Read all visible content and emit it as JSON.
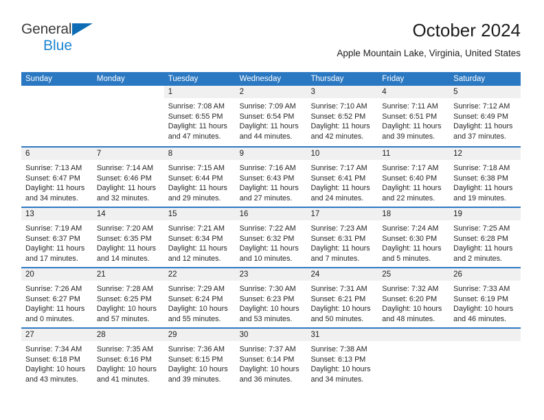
{
  "brand": {
    "name_part1": "General",
    "name_part2": "Blue",
    "triangle_color": "#0d6cb5",
    "blue_text_color": "#1a84d0"
  },
  "header": {
    "title": "October 2024",
    "subtitle": "Apple Mountain Lake, Virginia, United States",
    "header_bg_color": "#2b78c2",
    "daynum_band_color": "#f0f0f0"
  },
  "weekdays": [
    "Sunday",
    "Monday",
    "Tuesday",
    "Wednesday",
    "Thursday",
    "Friday",
    "Saturday"
  ],
  "weeks": [
    [
      {
        "day": "",
        "lines": []
      },
      {
        "day": "",
        "lines": []
      },
      {
        "day": "1",
        "lines": [
          "Sunrise: 7:08 AM",
          "Sunset: 6:55 PM",
          "Daylight: 11 hours",
          "and 47 minutes."
        ]
      },
      {
        "day": "2",
        "lines": [
          "Sunrise: 7:09 AM",
          "Sunset: 6:54 PM",
          "Daylight: 11 hours",
          "and 44 minutes."
        ]
      },
      {
        "day": "3",
        "lines": [
          "Sunrise: 7:10 AM",
          "Sunset: 6:52 PM",
          "Daylight: 11 hours",
          "and 42 minutes."
        ]
      },
      {
        "day": "4",
        "lines": [
          "Sunrise: 7:11 AM",
          "Sunset: 6:51 PM",
          "Daylight: 11 hours",
          "and 39 minutes."
        ]
      },
      {
        "day": "5",
        "lines": [
          "Sunrise: 7:12 AM",
          "Sunset: 6:49 PM",
          "Daylight: 11 hours",
          "and 37 minutes."
        ]
      }
    ],
    [
      {
        "day": "6",
        "lines": [
          "Sunrise: 7:13 AM",
          "Sunset: 6:47 PM",
          "Daylight: 11 hours",
          "and 34 minutes."
        ]
      },
      {
        "day": "7",
        "lines": [
          "Sunrise: 7:14 AM",
          "Sunset: 6:46 PM",
          "Daylight: 11 hours",
          "and 32 minutes."
        ]
      },
      {
        "day": "8",
        "lines": [
          "Sunrise: 7:15 AM",
          "Sunset: 6:44 PM",
          "Daylight: 11 hours",
          "and 29 minutes."
        ]
      },
      {
        "day": "9",
        "lines": [
          "Sunrise: 7:16 AM",
          "Sunset: 6:43 PM",
          "Daylight: 11 hours",
          "and 27 minutes."
        ]
      },
      {
        "day": "10",
        "lines": [
          "Sunrise: 7:17 AM",
          "Sunset: 6:41 PM",
          "Daylight: 11 hours",
          "and 24 minutes."
        ]
      },
      {
        "day": "11",
        "lines": [
          "Sunrise: 7:17 AM",
          "Sunset: 6:40 PM",
          "Daylight: 11 hours",
          "and 22 minutes."
        ]
      },
      {
        "day": "12",
        "lines": [
          "Sunrise: 7:18 AM",
          "Sunset: 6:38 PM",
          "Daylight: 11 hours",
          "and 19 minutes."
        ]
      }
    ],
    [
      {
        "day": "13",
        "lines": [
          "Sunrise: 7:19 AM",
          "Sunset: 6:37 PM",
          "Daylight: 11 hours",
          "and 17 minutes."
        ]
      },
      {
        "day": "14",
        "lines": [
          "Sunrise: 7:20 AM",
          "Sunset: 6:35 PM",
          "Daylight: 11 hours",
          "and 14 minutes."
        ]
      },
      {
        "day": "15",
        "lines": [
          "Sunrise: 7:21 AM",
          "Sunset: 6:34 PM",
          "Daylight: 11 hours",
          "and 12 minutes."
        ]
      },
      {
        "day": "16",
        "lines": [
          "Sunrise: 7:22 AM",
          "Sunset: 6:32 PM",
          "Daylight: 11 hours",
          "and 10 minutes."
        ]
      },
      {
        "day": "17",
        "lines": [
          "Sunrise: 7:23 AM",
          "Sunset: 6:31 PM",
          "Daylight: 11 hours",
          "and 7 minutes."
        ]
      },
      {
        "day": "18",
        "lines": [
          "Sunrise: 7:24 AM",
          "Sunset: 6:30 PM",
          "Daylight: 11 hours",
          "and 5 minutes."
        ]
      },
      {
        "day": "19",
        "lines": [
          "Sunrise: 7:25 AM",
          "Sunset: 6:28 PM",
          "Daylight: 11 hours",
          "and 2 minutes."
        ]
      }
    ],
    [
      {
        "day": "20",
        "lines": [
          "Sunrise: 7:26 AM",
          "Sunset: 6:27 PM",
          "Daylight: 11 hours",
          "and 0 minutes."
        ]
      },
      {
        "day": "21",
        "lines": [
          "Sunrise: 7:28 AM",
          "Sunset: 6:25 PM",
          "Daylight: 10 hours",
          "and 57 minutes."
        ]
      },
      {
        "day": "22",
        "lines": [
          "Sunrise: 7:29 AM",
          "Sunset: 6:24 PM",
          "Daylight: 10 hours",
          "and 55 minutes."
        ]
      },
      {
        "day": "23",
        "lines": [
          "Sunrise: 7:30 AM",
          "Sunset: 6:23 PM",
          "Daylight: 10 hours",
          "and 53 minutes."
        ]
      },
      {
        "day": "24",
        "lines": [
          "Sunrise: 7:31 AM",
          "Sunset: 6:21 PM",
          "Daylight: 10 hours",
          "and 50 minutes."
        ]
      },
      {
        "day": "25",
        "lines": [
          "Sunrise: 7:32 AM",
          "Sunset: 6:20 PM",
          "Daylight: 10 hours",
          "and 48 minutes."
        ]
      },
      {
        "day": "26",
        "lines": [
          "Sunrise: 7:33 AM",
          "Sunset: 6:19 PM",
          "Daylight: 10 hours",
          "and 46 minutes."
        ]
      }
    ],
    [
      {
        "day": "27",
        "lines": [
          "Sunrise: 7:34 AM",
          "Sunset: 6:18 PM",
          "Daylight: 10 hours",
          "and 43 minutes."
        ]
      },
      {
        "day": "28",
        "lines": [
          "Sunrise: 7:35 AM",
          "Sunset: 6:16 PM",
          "Daylight: 10 hours",
          "and 41 minutes."
        ]
      },
      {
        "day": "29",
        "lines": [
          "Sunrise: 7:36 AM",
          "Sunset: 6:15 PM",
          "Daylight: 10 hours",
          "and 39 minutes."
        ]
      },
      {
        "day": "30",
        "lines": [
          "Sunrise: 7:37 AM",
          "Sunset: 6:14 PM",
          "Daylight: 10 hours",
          "and 36 minutes."
        ]
      },
      {
        "day": "31",
        "lines": [
          "Sunrise: 7:38 AM",
          "Sunset: 6:13 PM",
          "Daylight: 10 hours",
          "and 34 minutes."
        ]
      },
      {
        "day": "",
        "lines": []
      },
      {
        "day": "",
        "lines": []
      }
    ]
  ]
}
